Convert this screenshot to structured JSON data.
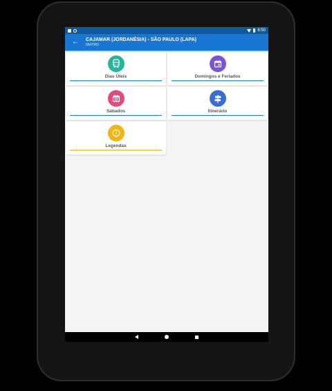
{
  "header": {
    "title": "CAJAMAR (JORDANÉSIA) - SÃO PAULO (LAPA)",
    "subtitle": "054TRO"
  },
  "status_bar": {
    "time": "8:50"
  },
  "menu": [
    {
      "label": "Dias Úteis",
      "icon": "bus-icon",
      "color": "#26b5a0"
    },
    {
      "label": "Domingos e Feriados",
      "icon": "calendar-icon",
      "color": "#7b55d6"
    },
    {
      "label": "Sábados",
      "icon": "calendar-icon",
      "color": "#e8477d"
    },
    {
      "label": "Itinerário",
      "icon": "signpost-icon",
      "color": "#3a6fd1"
    },
    {
      "label": "Legendas",
      "icon": "info-icon",
      "color": "#f0b414"
    }
  ],
  "underline_colors": [
    "#1976d2",
    "#1976d2",
    "#1976d2",
    "#1976d2",
    "#f0b414"
  ]
}
